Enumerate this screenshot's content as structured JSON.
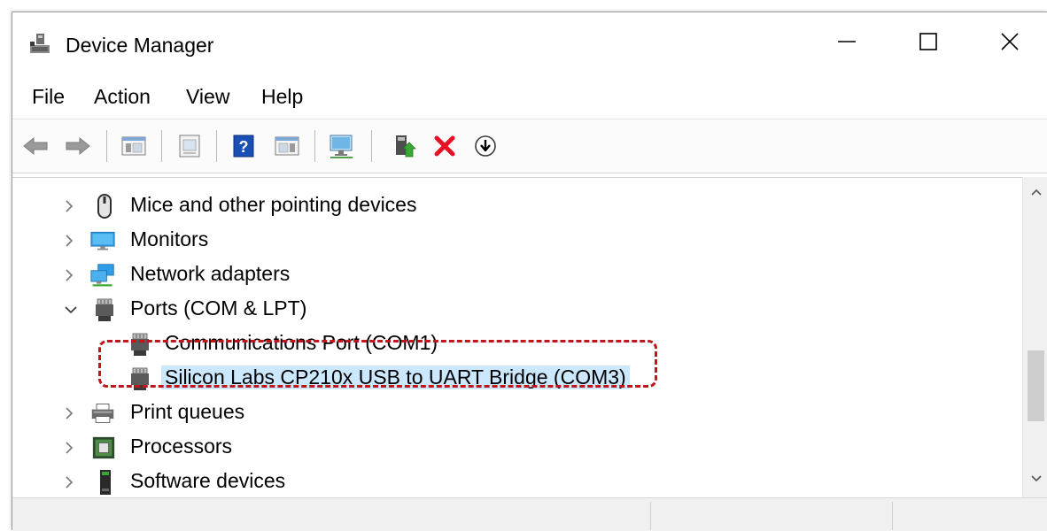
{
  "window": {
    "title": "Device Manager",
    "icon": "device-manager-icon",
    "controls": {
      "minimize": "minimize-icon",
      "maximize": "maximize-icon",
      "close": "close-icon"
    }
  },
  "menu": {
    "file": "File",
    "action": "Action",
    "view": "View",
    "help": "Help"
  },
  "toolbar": {
    "icons": [
      "back-arrow-icon",
      "forward-arrow-icon",
      "show-hide-console-tree-icon",
      "properties-icon",
      "help-icon",
      "show-action-pane-icon",
      "scan-hardware-icon",
      "update-driver-icon",
      "uninstall-device-icon",
      "disable-device-icon"
    ],
    "colors": {
      "uninstall": "#e81123",
      "update": "#3aa735",
      "help_blue": "#1a4fb5"
    }
  },
  "tree": {
    "items": [
      {
        "label": "Mice and other pointing devices",
        "icon": "mouse-icon",
        "expander": "collapsed"
      },
      {
        "label": "Monitors",
        "icon": "monitor-icon",
        "expander": "collapsed"
      },
      {
        "label": "Network adapters",
        "icon": "network-adapter-icon",
        "expander": "collapsed"
      },
      {
        "label": "Ports (COM & LPT)",
        "icon": "port-icon",
        "expander": "expanded"
      },
      {
        "label": "Communications Port (COM1)",
        "icon": "port-icon",
        "expander": "none"
      },
      {
        "label": "Silicon Labs CP210x USB to UART Bridge (COM3)",
        "icon": "port-icon",
        "expander": "none",
        "selected": true
      },
      {
        "label": "Print queues",
        "icon": "printer-icon",
        "expander": "collapsed"
      },
      {
        "label": "Processors",
        "icon": "processor-icon",
        "expander": "collapsed"
      },
      {
        "label": "Software devices",
        "icon": "software-device-icon",
        "expander": "collapsed"
      }
    ],
    "selection_color": "#cce8ff",
    "highlight_color": "#c0161b"
  }
}
